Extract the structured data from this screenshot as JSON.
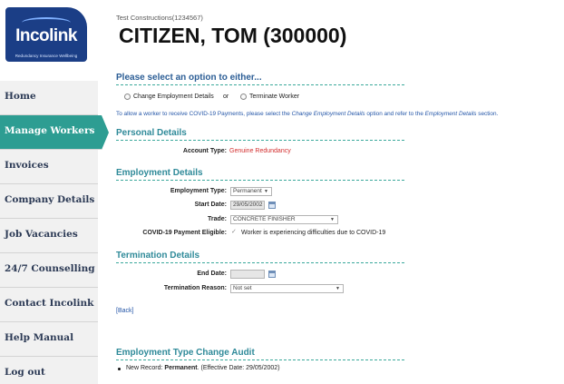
{
  "brand": {
    "logo_text": "Incolink",
    "tagline": "Redundancy Insurance Wellbeing",
    "color": "#1b3e86"
  },
  "accent": "#2d9d92",
  "sidebar": {
    "items": [
      {
        "label": "Home"
      },
      {
        "label": "Manage Workers",
        "active": true
      },
      {
        "label": "Invoices"
      },
      {
        "label": "Company Details"
      },
      {
        "label": "Job Vacancies"
      },
      {
        "label": "24/7 Counselling"
      },
      {
        "label": "Contact Incolink"
      },
      {
        "label": "Help Manual"
      },
      {
        "label": "Log out"
      }
    ]
  },
  "header": {
    "company": "Test Constructions(1234567)",
    "worker": "CITIZEN, TOM (300000)"
  },
  "options": {
    "heading": "Please select an option to either...",
    "change_label": "Change Employment Details",
    "or_label": "or",
    "terminate_label": "Terminate Worker",
    "info_pre": "To allow a worker to receive COVID-19 Payments, please select the ",
    "info_em1": "Change Employment Details",
    "info_mid": " option and refer to the ",
    "info_em2": "Employment Details",
    "info_post": " section."
  },
  "personal": {
    "heading": "Personal Details",
    "account_type_label": "Account Type:",
    "account_type_value": "Genuine Redundancy"
  },
  "employment": {
    "heading": "Employment Details",
    "type_label": "Employment Type:",
    "type_value": "Permanent",
    "start_label": "Start Date:",
    "start_value": "29/05/2002",
    "trade_label": "Trade:",
    "trade_value": "CONCRETE FINISHER",
    "covid_label": "COVID-19 Payment Eligible:",
    "covid_text": "Worker is experiencing difficulties due to COVID-19"
  },
  "termination": {
    "heading": "Termination Details",
    "end_label": "End Date:",
    "end_value": "",
    "reason_label": "Termination Reason:",
    "reason_value": "Not set"
  },
  "back_label": "[Back]",
  "audit": {
    "heading": "Employment Type Change Audit",
    "prefix": "New Record: ",
    "type": "Permanent",
    "suffix": ". (Effective Date: 29/05/2002)"
  }
}
